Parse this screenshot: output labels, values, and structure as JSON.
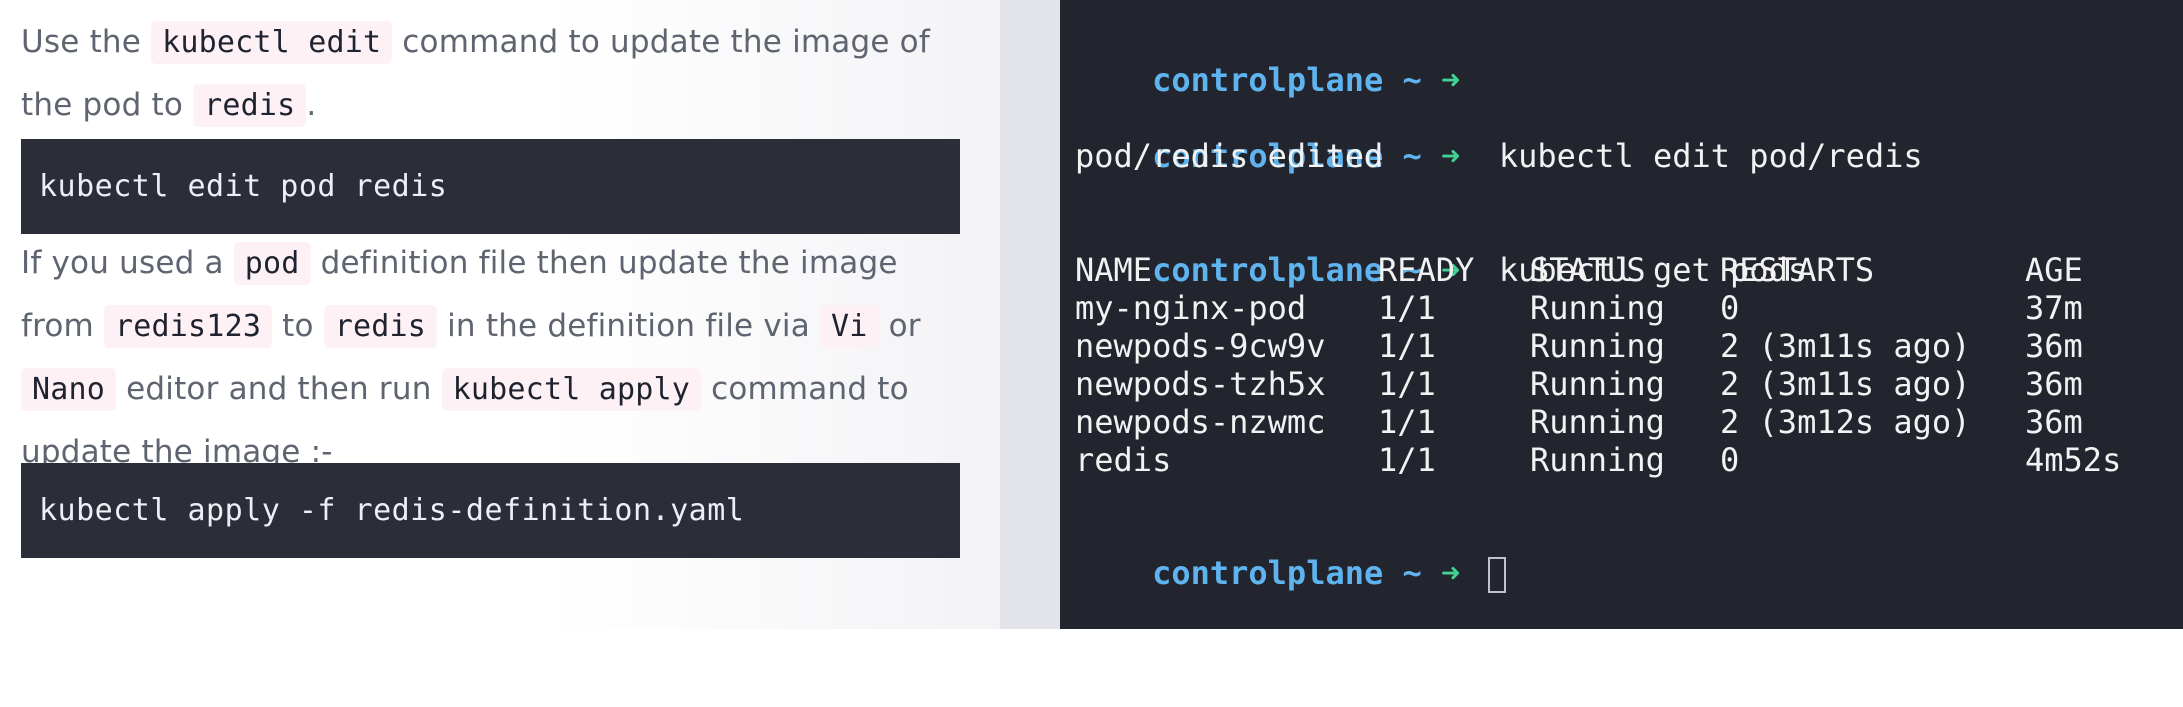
{
  "instructions": {
    "p1": {
      "t1": "Use the ",
      "c1": "kubectl edit",
      "t2": " command to update the image of the pod to ",
      "c2": "redis",
      "t3": "."
    },
    "code_block_1": "kubectl edit pod redis",
    "p2": {
      "t1": "If you used a ",
      "c1": "pod",
      "t2": " definition file then update the image from ",
      "c2": "redis123",
      "t3": " to ",
      "c3": "redis",
      "t4": " in the definition file via ",
      "c4": "Vi",
      "t5": " or ",
      "c5": "Nano",
      "t6": " editor and then run ",
      "c6": "kubectl apply",
      "t7": " command to update the image :-"
    },
    "code_block_2": "kubectl apply -f redis-definition.yaml"
  },
  "terminal": {
    "prompt_host": "controlplane",
    "prompt_tilde": "~",
    "prompt_arrow": "➜",
    "cmd1": "kubectl edit pod/redis",
    "out1": "pod/redis edited",
    "cmd2": "kubectl get pods",
    "table": {
      "headers": [
        "NAME",
        "READY",
        "STATUS",
        "RESTARTS",
        "AGE"
      ],
      "rows": [
        [
          "my-nginx-pod",
          "1/1",
          "Running",
          "0",
          "37m"
        ],
        [
          "newpods-9cw9v",
          "1/1",
          "Running",
          "2 (3m11s ago)",
          "36m"
        ],
        [
          "newpods-tzh5x",
          "1/1",
          "Running",
          "2 (3m11s ago)",
          "36m"
        ],
        [
          "newpods-nzwmc",
          "1/1",
          "Running",
          "2 (3m12s ago)",
          "36m"
        ],
        [
          "redis",
          "1/1",
          "Running",
          "0",
          "4m52s"
        ]
      ]
    }
  }
}
